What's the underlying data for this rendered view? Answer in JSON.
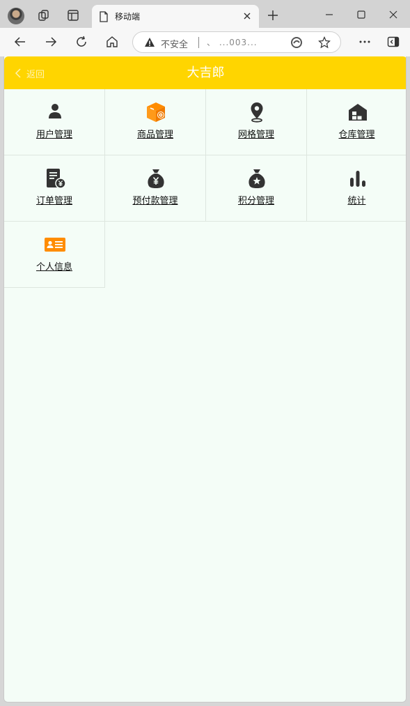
{
  "browser": {
    "tab_title": "移动端",
    "security_label": "不安全",
    "url_text": "、        ...003..."
  },
  "app": {
    "back_label": "返回",
    "title": "大吉郎",
    "header_color": "#ffd500",
    "background": "#f4fdf7"
  },
  "menu": [
    {
      "label": "用户管理",
      "icon": "user-icon"
    },
    {
      "label": "商品管理",
      "icon": "product-box-icon"
    },
    {
      "label": "网格管理",
      "icon": "location-pin-icon"
    },
    {
      "label": "仓库管理",
      "icon": "warehouse-icon"
    },
    {
      "label": "订单管理",
      "icon": "order-bill-icon"
    },
    {
      "label": "预付款管理",
      "icon": "money-bag-icon"
    },
    {
      "label": "积分管理",
      "icon": "points-bag-icon"
    },
    {
      "label": "统计",
      "icon": "bar-chart-icon"
    },
    {
      "label": "个人信息",
      "icon": "id-card-icon"
    }
  ]
}
